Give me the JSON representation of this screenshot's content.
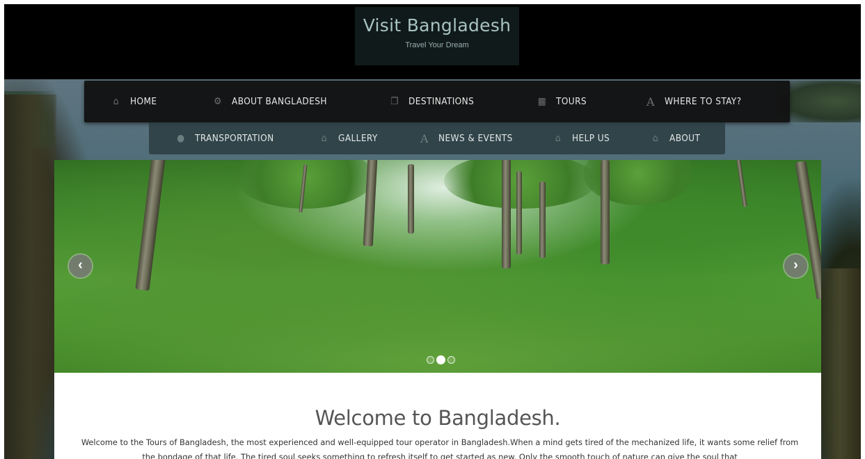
{
  "header": {
    "brand_title": "Visit Bangladesh",
    "brand_tagline": "Travel Your Dream"
  },
  "nav": {
    "primary": [
      {
        "label": "HOME",
        "icon": "home-icon"
      },
      {
        "label": "ABOUT BANGLADESH",
        "icon": "gears-icon"
      },
      {
        "label": "DESTINATIONS",
        "icon": "copy-icon"
      },
      {
        "label": "TOURS",
        "icon": "grid-icon"
      },
      {
        "label": "WHERE TO STAY?",
        "icon": "font-icon"
      }
    ],
    "secondary": [
      {
        "label": "TRANSPORTATION",
        "icon": "comment-icon"
      },
      {
        "label": "GALLERY",
        "icon": "home-icon"
      },
      {
        "label": "NEWS & EVENTS",
        "icon": "font-icon"
      },
      {
        "label": "HELP US",
        "icon": "home-icon"
      },
      {
        "label": "ABOUT",
        "icon": "home-icon"
      }
    ]
  },
  "slider": {
    "prev_glyph": "‹",
    "next_glyph": "›",
    "slide_count": 3,
    "active_slide": 2
  },
  "welcome": {
    "title": "Welcome to Bangladesh.",
    "text": "Welcome to the Tours of Bangladesh, the most experienced and well-equipped tour operator in Bangladesh.When a mind gets tired of the mechanized life, it wants some relief from the bondage of that life. The tired soul seeks something to refresh itself to get started as new. Only the smooth touch of nature can give the soul that"
  },
  "colors": {
    "header_bg": "#000000",
    "brand_bg": "#111a1a",
    "nav_primary_bg": "#121212",
    "nav_secondary_bg": "#283a3e",
    "title_text": "#555555"
  }
}
